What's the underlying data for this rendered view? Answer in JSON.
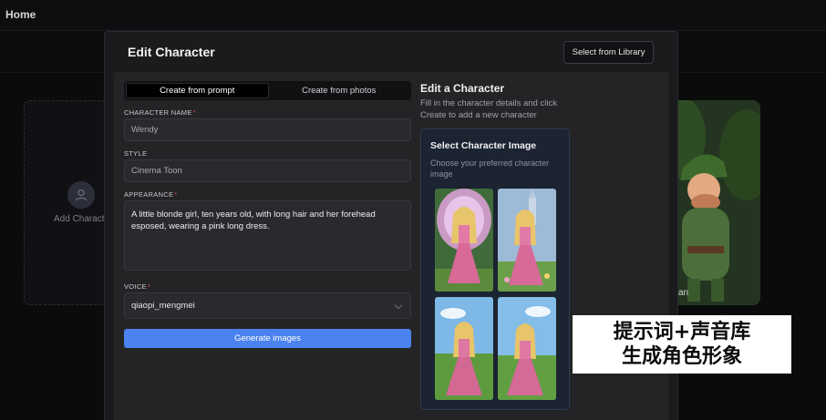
{
  "topbar": {
    "title": "Home"
  },
  "background": {
    "add_card_label": "Add Characte",
    "character_name_partial": "an"
  },
  "modal": {
    "title": "Edit Character",
    "library_button": "Select from Library",
    "tabs": [
      {
        "label": "Create from prompt",
        "active": true
      },
      {
        "label": "Create from photos",
        "active": false
      }
    ],
    "form": {
      "name_label": "CHARACTER NAME",
      "name_value": "Wendy",
      "style_label": "STYLE",
      "style_value": "Cinema Toon",
      "appearance_label": "APPEARANCE",
      "appearance_value": "A little blonde girl, ten years old, with long hair and her forehead esposed, wearing a pink long dress.",
      "voice_label": "VOICE",
      "voice_value": "qiaopi_mengmei",
      "required_mark": "*",
      "generate_button": "Generate images"
    },
    "right": {
      "title": "Edit a Character",
      "description": "Fill in the character details and click Create to add a new character",
      "panel_title": "Select Character Image",
      "panel_description": "Choose your preferred character image"
    }
  },
  "caption": {
    "line1": "提示词+声音库",
    "line2": "生成角色形象"
  },
  "colors": {
    "accent": "#4a82f0",
    "required": "#e5484d",
    "panel_bg": "#1c2331"
  }
}
